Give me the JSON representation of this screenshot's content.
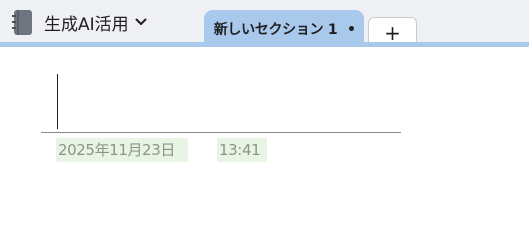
{
  "notebook": {
    "name": "生成AI活用",
    "icon": "notebook-icon",
    "dropdown_icon": "chevron-down-icon"
  },
  "tabs": {
    "active": {
      "label": "新しいセクション 1",
      "indicator_icon": "dot-icon"
    },
    "add_label": "+"
  },
  "page": {
    "title": "",
    "date": "2025年11月23日",
    "time": "13:41"
  },
  "colors": {
    "topbar": "#eef0f3",
    "active_tab": "#a9c9ec",
    "meta_highlight": "#e8f5e4"
  }
}
